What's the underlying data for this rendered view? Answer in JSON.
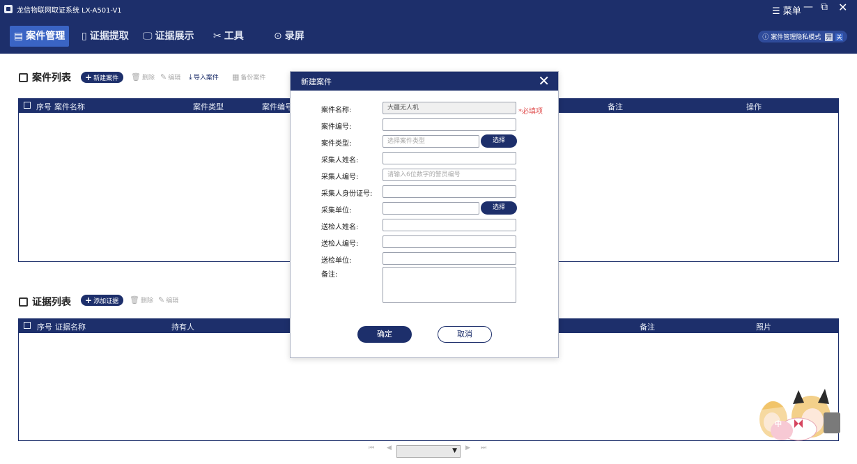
{
  "window": {
    "title": "龙信物联网取证系统 LX-A501-V1",
    "menu_label": "菜单"
  },
  "nav": {
    "items": [
      {
        "label": "案件管理"
      },
      {
        "label": "证据提取"
      },
      {
        "label": "证据展示"
      },
      {
        "label": "工具"
      },
      {
        "label": "录屏"
      }
    ],
    "privacy_mode": "案件管理隐私模式",
    "privacy_key_1": "开",
    "privacy_key_2": "关"
  },
  "case_section": {
    "title": "案件列表",
    "new_button": "新建案件",
    "delete": "删除",
    "edit": "编辑",
    "import": "导入案件",
    "backup": "备份案件",
    "columns": {
      "seq": "序号",
      "name": "案件名称",
      "type": "案件类型",
      "number": "案件编号",
      "remark": "备注",
      "ops": "操作"
    }
  },
  "evidence_section": {
    "title": "证据列表",
    "add_button": "添加证据",
    "delete": "删除",
    "edit": "编辑",
    "columns": {
      "seq": "序号",
      "name": "证据名称",
      "holder": "持有人",
      "remark": "备注",
      "photo": "照片"
    }
  },
  "dialog": {
    "title": "新建案件",
    "required_hint": "*必填项",
    "select_label": "选择",
    "fields": {
      "case_name": {
        "label": "案件名称:",
        "value": "大疆无人机"
      },
      "case_number": {
        "label": "案件编号:",
        "value": ""
      },
      "case_type": {
        "label": "案件类型:",
        "placeholder": "选择案件类型"
      },
      "collector_name": {
        "label": "采集人姓名:",
        "value": ""
      },
      "collector_number": {
        "label": "采集人编号:",
        "placeholder": "请输入6位数字的警员编号"
      },
      "collector_id": {
        "label": "采集人身份证号:",
        "value": ""
      },
      "collector_unit": {
        "label": "采集单位:",
        "value": ""
      },
      "submitter_name": {
        "label": "送检人姓名:",
        "value": ""
      },
      "submitter_number": {
        "label": "送检人编号:",
        "value": ""
      },
      "submitter_unit": {
        "label": "送检单位:",
        "value": ""
      },
      "remark": {
        "label": "备注:",
        "value": ""
      }
    },
    "ok": "确定",
    "cancel": "取消"
  },
  "pager": {
    "first": "⏮",
    "prev": "◀",
    "next": "▶",
    "last": "⏭",
    "current": ""
  },
  "mascot": {
    "badge": "中"
  },
  "colors": {
    "primary": "#1d2f6b",
    "active_tab": "#3a64c4",
    "required": "#e05050"
  }
}
